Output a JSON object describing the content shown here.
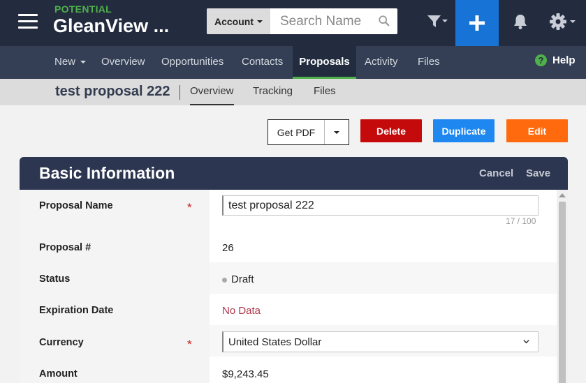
{
  "header": {
    "subtitle": "POTENTIAL",
    "title": "GleanView ...",
    "search": {
      "account_label": "Account",
      "placeholder": "Search Name"
    },
    "icons": [
      "menu-icon",
      "search-icon",
      "filter-icon",
      "plus-icon",
      "bell-icon",
      "gear-icon"
    ],
    "accent_color": "#1774d6"
  },
  "nav": {
    "items": [
      {
        "label": "New"
      },
      {
        "label": "Overview"
      },
      {
        "label": "Opportunities"
      },
      {
        "label": "Contacts"
      },
      {
        "label": "Proposals",
        "active": true
      },
      {
        "label": "Activity"
      },
      {
        "label": "Files"
      }
    ],
    "help_label": "Help"
  },
  "record": {
    "title": "test proposal 222",
    "tabs": [
      {
        "label": "Overview",
        "active": true
      },
      {
        "label": "Tracking"
      },
      {
        "label": "Files"
      }
    ]
  },
  "actions": {
    "pdf_label": "Get PDF",
    "delete_label": "Delete",
    "duplicate_label": "Duplicate",
    "edit_label": "Edit",
    "colors": {
      "delete": "#c40a0a",
      "duplicate": "#1e87f0",
      "edit": "#ff6a0f"
    }
  },
  "panel": {
    "title": "Basic Information",
    "cancel_label": "Cancel",
    "save_label": "Save",
    "fields": {
      "proposal_name": {
        "label": "Proposal Name",
        "required_mark": "*",
        "value": "test proposal 222",
        "counter": "17 / 100"
      },
      "proposal_number": {
        "label": "Proposal #",
        "value": "26"
      },
      "status": {
        "label": "Status",
        "value": "Draft"
      },
      "expiration_date": {
        "label": "Expiration Date",
        "value": "No Data"
      },
      "currency": {
        "label": "Currency",
        "required_mark": "*",
        "value": "United States Dollar"
      },
      "amount": {
        "label": "Amount",
        "value": "$9,243.45"
      }
    }
  }
}
